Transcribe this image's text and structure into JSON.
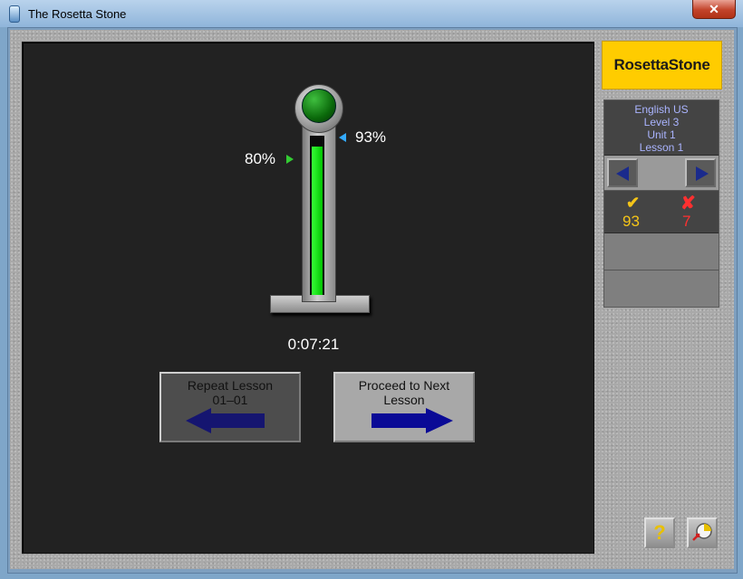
{
  "window": {
    "title": "The Rosetta Stone",
    "close_label": "✕"
  },
  "logo": {
    "text": "RosettaStone",
    "tm": "™"
  },
  "lesson_info": {
    "language": "English US",
    "level": "Level 3",
    "unit": "Unit 1",
    "lesson": "Lesson 1"
  },
  "navigation": {
    "prev_icon": "left-triangle-icon",
    "next_icon": "right-triangle-icon"
  },
  "score": {
    "correct_symbol": "✔",
    "incorrect_symbol": "✘",
    "correct": "93",
    "incorrect": "7"
  },
  "meter": {
    "target_label": "80%",
    "score_label": "93%",
    "score_fraction": 0.93,
    "target_fraction": 0.8
  },
  "timer": "0:07:21",
  "buttons": {
    "repeat_line1": "Repeat Lesson",
    "repeat_line2": "01–01",
    "proceed_line1": "Proceed to Next",
    "proceed_line2": "Lesson",
    "help_label": "?",
    "exit_icon": "exit-icon"
  },
  "colors": {
    "brand": "#ffcc00",
    "meter_green": "#22e022",
    "correct": "#f5c518",
    "incorrect": "#ff3030",
    "nav_arrow": "#1a2a8c"
  }
}
